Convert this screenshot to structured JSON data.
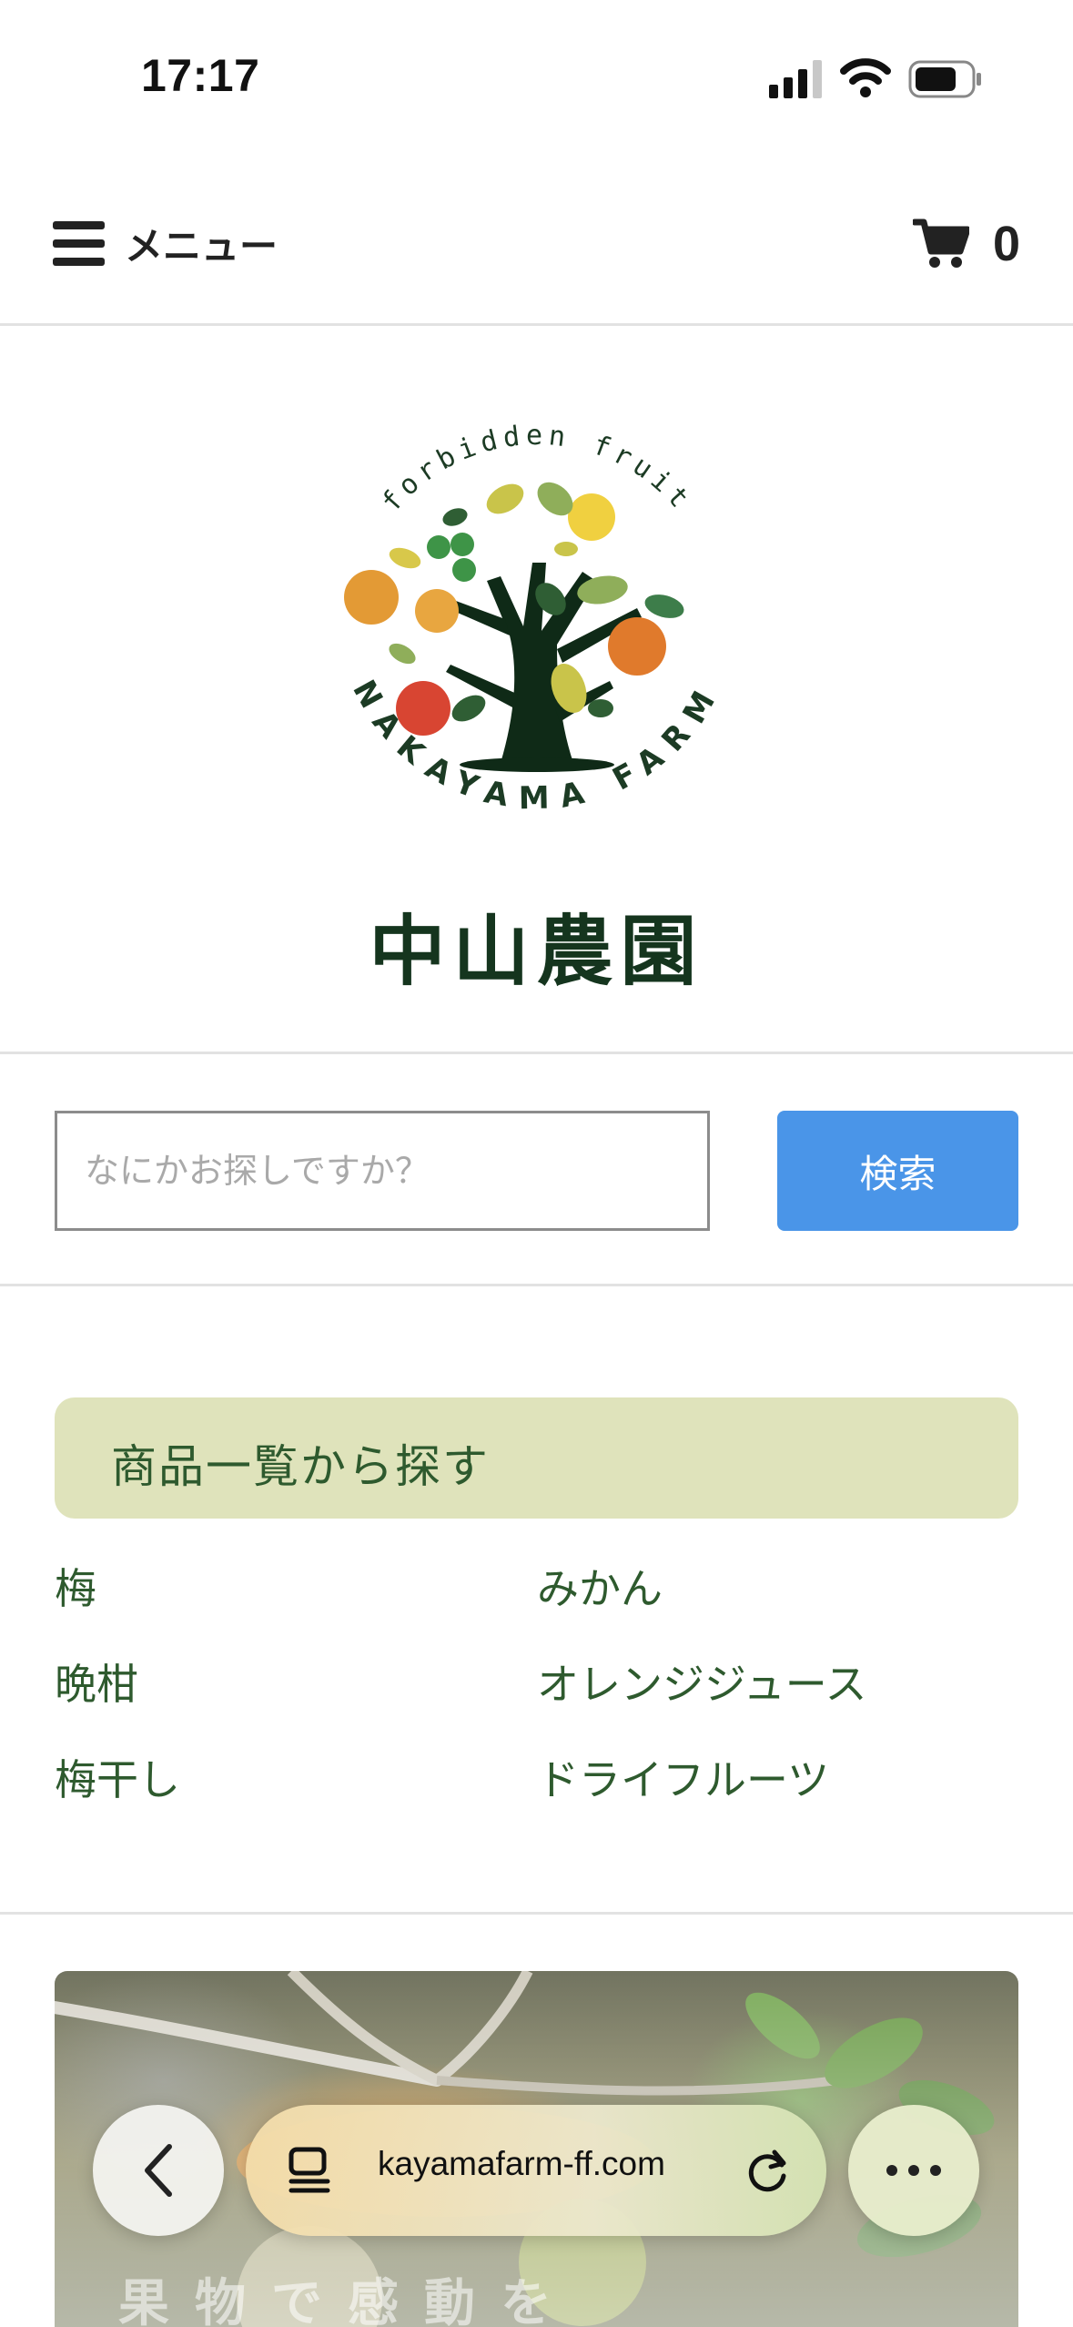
{
  "status_bar": {
    "time": "17:17"
  },
  "header": {
    "menu_label": "メニュー",
    "cart_count": "0"
  },
  "logo": {
    "arc_text": "forbidden fruit",
    "bottom_text": "NAKAYAMA FARM",
    "jp_name": "中山農園"
  },
  "search": {
    "placeholder": "なにかお探しですか？",
    "button_label": "検索"
  },
  "categories": {
    "title": "商品一覧から探す",
    "items": [
      "梅",
      "みかん",
      "晩柑",
      "オレンジジュース",
      "梅干し",
      "ドライフルーツ"
    ]
  },
  "hero": {
    "caption": "果物で感動を"
  },
  "browser": {
    "url": "kayamafarm-ff.com"
  }
}
